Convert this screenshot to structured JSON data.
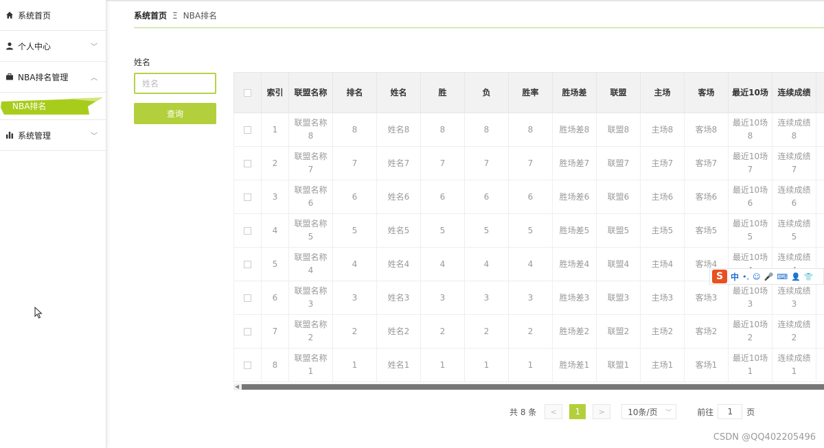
{
  "sidebar": {
    "items": [
      {
        "label": "系统首页",
        "icon": "home-icon"
      },
      {
        "label": "个人中心",
        "icon": "user-icon"
      },
      {
        "label": "NBA排名管理",
        "icon": "briefcase-icon"
      },
      {
        "label": "系统管理",
        "icon": "bar-chart-icon"
      }
    ],
    "sub_item": {
      "label": "NBA排名"
    }
  },
  "breadcrumb": {
    "home": "系统首页",
    "separator": "Ξ",
    "current": "NBA排名"
  },
  "search": {
    "label": "姓名",
    "placeholder": "姓名",
    "button": "查询"
  },
  "table": {
    "headers": [
      "索引",
      "联盟名称",
      "排名",
      "姓名",
      "胜",
      "负",
      "胜率",
      "胜场差",
      "联盟",
      "主场",
      "客场",
      "最近10场",
      "连续成绩"
    ],
    "rows": [
      [
        "1",
        "联盟名称8",
        "8",
        "姓名8",
        "8",
        "8",
        "8",
        "胜场差8",
        "联盟8",
        "主场8",
        "客场8",
        "最近10场8",
        "连续成绩8"
      ],
      [
        "2",
        "联盟名称7",
        "7",
        "姓名7",
        "7",
        "7",
        "7",
        "胜场差7",
        "联盟7",
        "主场7",
        "客场7",
        "最近10场7",
        "连续成绩7"
      ],
      [
        "3",
        "联盟名称6",
        "6",
        "姓名6",
        "6",
        "6",
        "6",
        "胜场差6",
        "联盟6",
        "主场6",
        "客场6",
        "最近10场6",
        "连续成绩6"
      ],
      [
        "4",
        "联盟名称5",
        "5",
        "姓名5",
        "5",
        "5",
        "5",
        "胜场差5",
        "联盟5",
        "主场5",
        "客场5",
        "最近10场5",
        "连续成绩5"
      ],
      [
        "5",
        "联盟名称4",
        "4",
        "姓名4",
        "4",
        "4",
        "4",
        "胜场差4",
        "联盟4",
        "主场4",
        "客场4",
        "最近10场4",
        "连续成绩4"
      ],
      [
        "6",
        "联盟名称3",
        "3",
        "姓名3",
        "3",
        "3",
        "3",
        "胜场差3",
        "联盟3",
        "主场3",
        "客场3",
        "最近10场3",
        "连续成绩3"
      ],
      [
        "7",
        "联盟名称2",
        "2",
        "姓名2",
        "2",
        "2",
        "2",
        "胜场差2",
        "联盟2",
        "主场2",
        "客场2",
        "最近10场2",
        "连续成绩2"
      ],
      [
        "8",
        "联盟名称1",
        "1",
        "姓名1",
        "1",
        "1",
        "1",
        "胜场差1",
        "联盟1",
        "主场1",
        "客场1",
        "最近10场1",
        "连续成绩1"
      ]
    ]
  },
  "pagination": {
    "total": "共 8 条",
    "prev": "<",
    "current_page": "1",
    "next": ">",
    "page_size": "10条/页",
    "goto_prefix": "前往",
    "goto_value": "1",
    "goto_suffix": "页"
  },
  "ime_toolbar": {
    "logo": "S",
    "mode": "中"
  },
  "watermark": "CSDN @QQ402205496",
  "colors": {
    "accent": "#b3d03c",
    "brush": "#a8cc1c"
  }
}
